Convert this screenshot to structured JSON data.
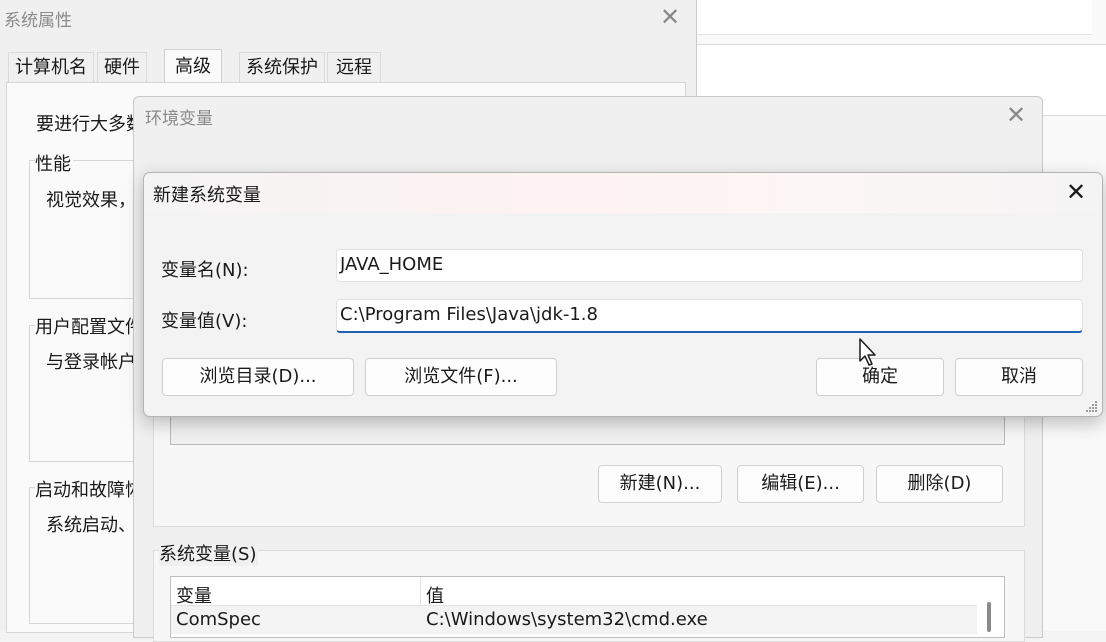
{
  "sys_props": {
    "title": "系统属性",
    "tabs": [
      "计算机名",
      "硬件",
      "高级",
      "系统保护",
      "远程"
    ],
    "active_tab": "高级",
    "intro_text": "要进行大多数",
    "performance": {
      "label": "性能",
      "desc": "视觉效果，"
    },
    "user_profiles": {
      "label": "用户配置文件",
      "desc": "与登录帐户"
    },
    "startup": {
      "label": "启动和故障恢",
      "desc": "系统启动、"
    }
  },
  "env_vars": {
    "title": "环境变量",
    "user_buttons": {
      "new": "新建(N)...",
      "edit": "编辑(E)...",
      "delete": "删除(D)"
    },
    "system_section_label": "系统变量(S)",
    "table": {
      "headers": [
        "变量",
        "值"
      ],
      "rows": [
        {
          "name": "ComSpec",
          "value": "C:\\Windows\\system32\\cmd.exe"
        }
      ]
    }
  },
  "new_var_dialog": {
    "title": "新建系统变量",
    "name_label": "变量名(N):",
    "name_value": "JAVA_HOME",
    "value_label": "变量值(V):",
    "value_value": "C:\\Program Files\\Java\\jdk-1.8",
    "browse_dir": "浏览目录(D)...",
    "browse_file": "浏览文件(F)...",
    "ok": "确定",
    "cancel": "取消"
  },
  "colors": {
    "accent": "#1f5fb4",
    "dialog_bg": "#f3f3f3",
    "window_bg": "#f0f0f0"
  }
}
